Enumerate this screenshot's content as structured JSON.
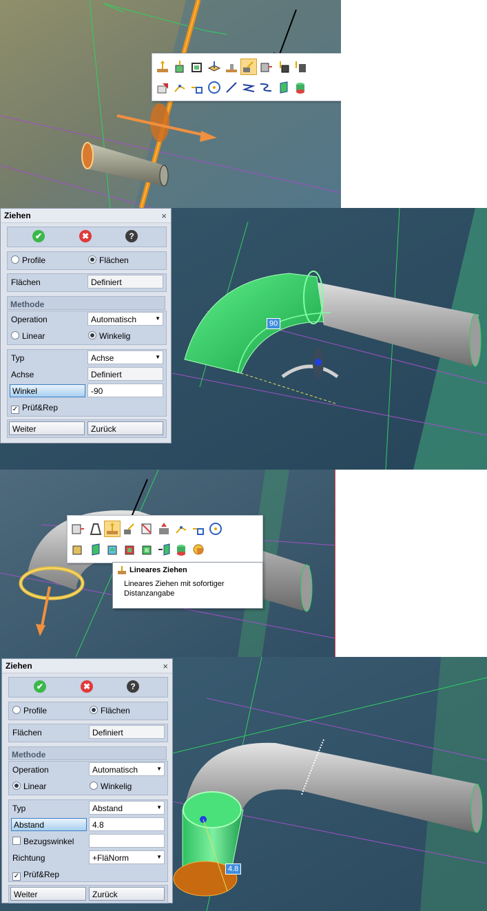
{
  "toolbar_top": {
    "row1_icons": [
      "linear-extrude-icon",
      "extrude-box-icon",
      "extrude-frame-icon",
      "extrude-plane-icon",
      "extrude-step-icon",
      "extrude-angle-icon",
      "extrude-block-icon",
      "extrude-down-icon",
      "extrude-down-block-icon"
    ],
    "row2_icons": [
      "eraser-face-icon",
      "point-line-icon",
      "corner-square-icon",
      "circle-center-icon",
      "diagonal-line-icon",
      "zigzag-line-icon",
      "s-curve-icon",
      "green-panel-icon",
      "green-cylinder-icon"
    ]
  },
  "toolbar_mid": {
    "row1_icons": [
      "extrude-face-icon",
      "revolve-outline-icon",
      "linear-extrude-icon",
      "extrude-angle-icon",
      "face-arrow-icon",
      "flip-height-icon",
      "point-line-icon",
      "corner-square-icon",
      "circle-center-icon"
    ],
    "row2_icons": [
      "box-face-icon",
      "green-panel-icon",
      "cube-arrow-icon",
      "red-cube-icon",
      "green-cube-icon",
      "arrow-panel-icon",
      "green-cylinder-icon",
      "yellow-shape-icon"
    ]
  },
  "tooltip": {
    "title": "Lineares Ziehen",
    "desc": "Lineares Ziehen mit sofortiger Distanzangabe"
  },
  "dialog1": {
    "title": "Ziehen",
    "close": "×",
    "ok": "✔",
    "cancel": "✖",
    "help": "?",
    "profile": "Profile",
    "flaechen_radio": "Flächen",
    "flaechen_label": "Flächen",
    "flaechen_value": "Definiert",
    "methode": "Methode",
    "operation_label": "Operation",
    "operation_value": "Automatisch",
    "linear": "Linear",
    "winkelig": "Winkelig",
    "typ_label": "Typ",
    "typ_value": "Achse",
    "achse_label": "Achse",
    "achse_value": "Definiert",
    "winkel_label": "Winkel",
    "winkel_value": "-90",
    "pruef": "Prüf&Rep",
    "weiter": "Weiter",
    "zurueck": "Zurück",
    "mode": "winkelig"
  },
  "dialog2": {
    "title": "Ziehen",
    "close": "×",
    "ok": "✔",
    "cancel": "✖",
    "help": "?",
    "profile": "Profile",
    "flaechen_radio": "Flächen",
    "flaechen_label": "Flächen",
    "flaechen_value": "Definiert",
    "methode": "Methode",
    "operation_label": "Operation",
    "operation_value": "Automatisch",
    "linear": "Linear",
    "winkelig": "Winkelig",
    "typ_label": "Typ",
    "typ_value": "Abstand",
    "abstand_label": "Abstand",
    "abstand_value": "4.8",
    "bezugswinkel": "Bezugswinkel",
    "richtung_label": "Richtung",
    "richtung_value": "+FläNorm",
    "pruef": "Prüf&Rep",
    "weiter": "Weiter",
    "zurueck": "Zurück",
    "mode": "linear"
  },
  "badges": {
    "angle": "90",
    "distance": "4.8"
  },
  "colors": {
    "accent_blue": "#3f8ddd",
    "selection_green": "#33dd66",
    "orange": "#f09020",
    "viewport_dark": "#2e4a5e"
  }
}
